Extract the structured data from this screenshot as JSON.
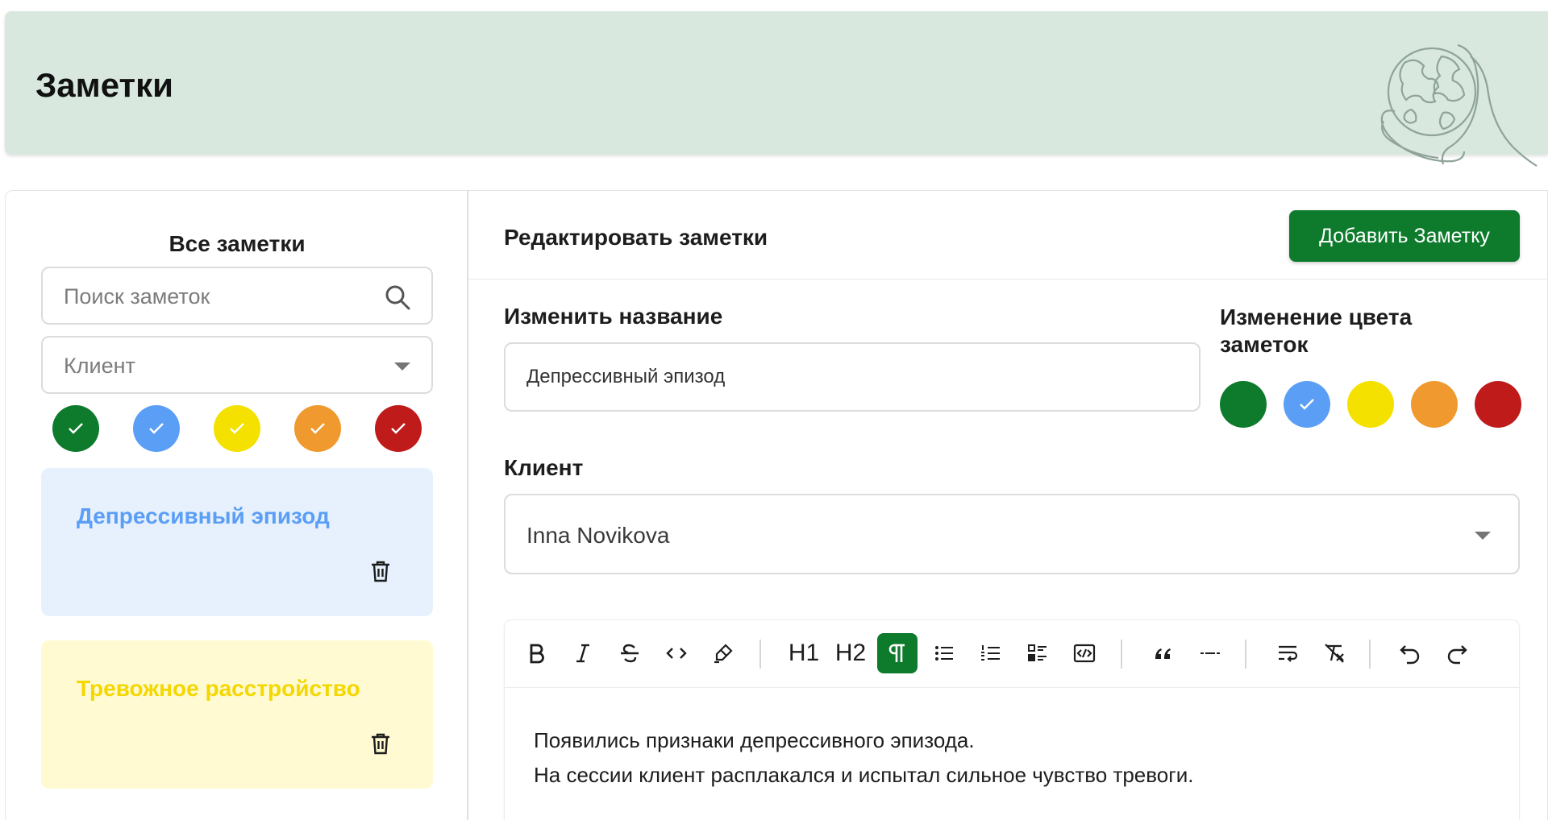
{
  "header": {
    "title": "Заметки"
  },
  "sidebar": {
    "title": "Все заметки",
    "search_placeholder": "Поиск заметок",
    "client_filter_label": "Клиент",
    "filter_colors": [
      {
        "name": "green",
        "hex": "#0d7a2c",
        "checked": true
      },
      {
        "name": "blue",
        "hex": "#5b9ef6",
        "checked": true
      },
      {
        "name": "yellow",
        "hex": "#f5e100",
        "checked": true
      },
      {
        "name": "orange",
        "hex": "#f0992e",
        "checked": true
      },
      {
        "name": "red",
        "hex": "#bf1b1b",
        "checked": true
      }
    ],
    "notes": [
      {
        "title": "Депрессивный эпизод",
        "bg": "#e7f1fd",
        "color": "#5b9ef6"
      },
      {
        "title": "Тревожное расстройство",
        "bg": "#fffad1",
        "color": "#f5d700"
      }
    ]
  },
  "main": {
    "title": "Редактировать заметки",
    "add_button": "Добавить Заметку",
    "name_label": "Изменить название",
    "name_value": "Депрессивный эпизод",
    "color_label": "Изменение цвета заметок",
    "note_colors": [
      {
        "name": "green",
        "hex": "#0d7a2c",
        "selected": false
      },
      {
        "name": "blue",
        "hex": "#5b9ef6",
        "selected": true
      },
      {
        "name": "yellow",
        "hex": "#f5e100",
        "selected": false
      },
      {
        "name": "orange",
        "hex": "#f0992e",
        "selected": false
      },
      {
        "name": "red",
        "hex": "#bf1b1b",
        "selected": false
      }
    ],
    "client_label": "Клиент",
    "client_value": "Inna Novikova",
    "toolbar": {
      "h1": "H1",
      "h2": "H2",
      "active_button": "paragraph"
    },
    "editor_lines": [
      "Появились признаки депрессивного эпизода.",
      "На сессии клиент расплакался и испытал сильное чувство тревоги."
    ]
  }
}
